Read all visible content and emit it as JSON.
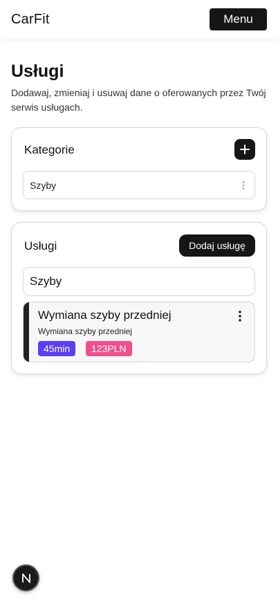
{
  "header": {
    "brand": "CarFit",
    "menu_label": "Menu"
  },
  "page": {
    "title": "Usługi",
    "description": "Dodawaj, zmieniaj i usuwaj dane o oferowanych przez Twój serwis usługach."
  },
  "categories": {
    "title": "Kategorie",
    "items": [
      {
        "label": "Szyby"
      }
    ]
  },
  "services": {
    "title": "Usługi",
    "add_label": "Dodaj usługę",
    "filter_value": "Szyby",
    "items": [
      {
        "name": "Wymiana szyby przedniej",
        "description": "Wymiana szyby przedniej",
        "duration": "45min",
        "price": "123PLN"
      }
    ]
  },
  "colors": {
    "accent_dark": "#161616",
    "duration_badge": "#5b3df6",
    "price_badge": "#ef4f8d"
  },
  "icons": {
    "add_category": "plus-icon",
    "category_menu": "vertical-dots-icon",
    "service_menu": "vertical-dots-icon",
    "dev_badge": "nextjs-logo-icon"
  }
}
